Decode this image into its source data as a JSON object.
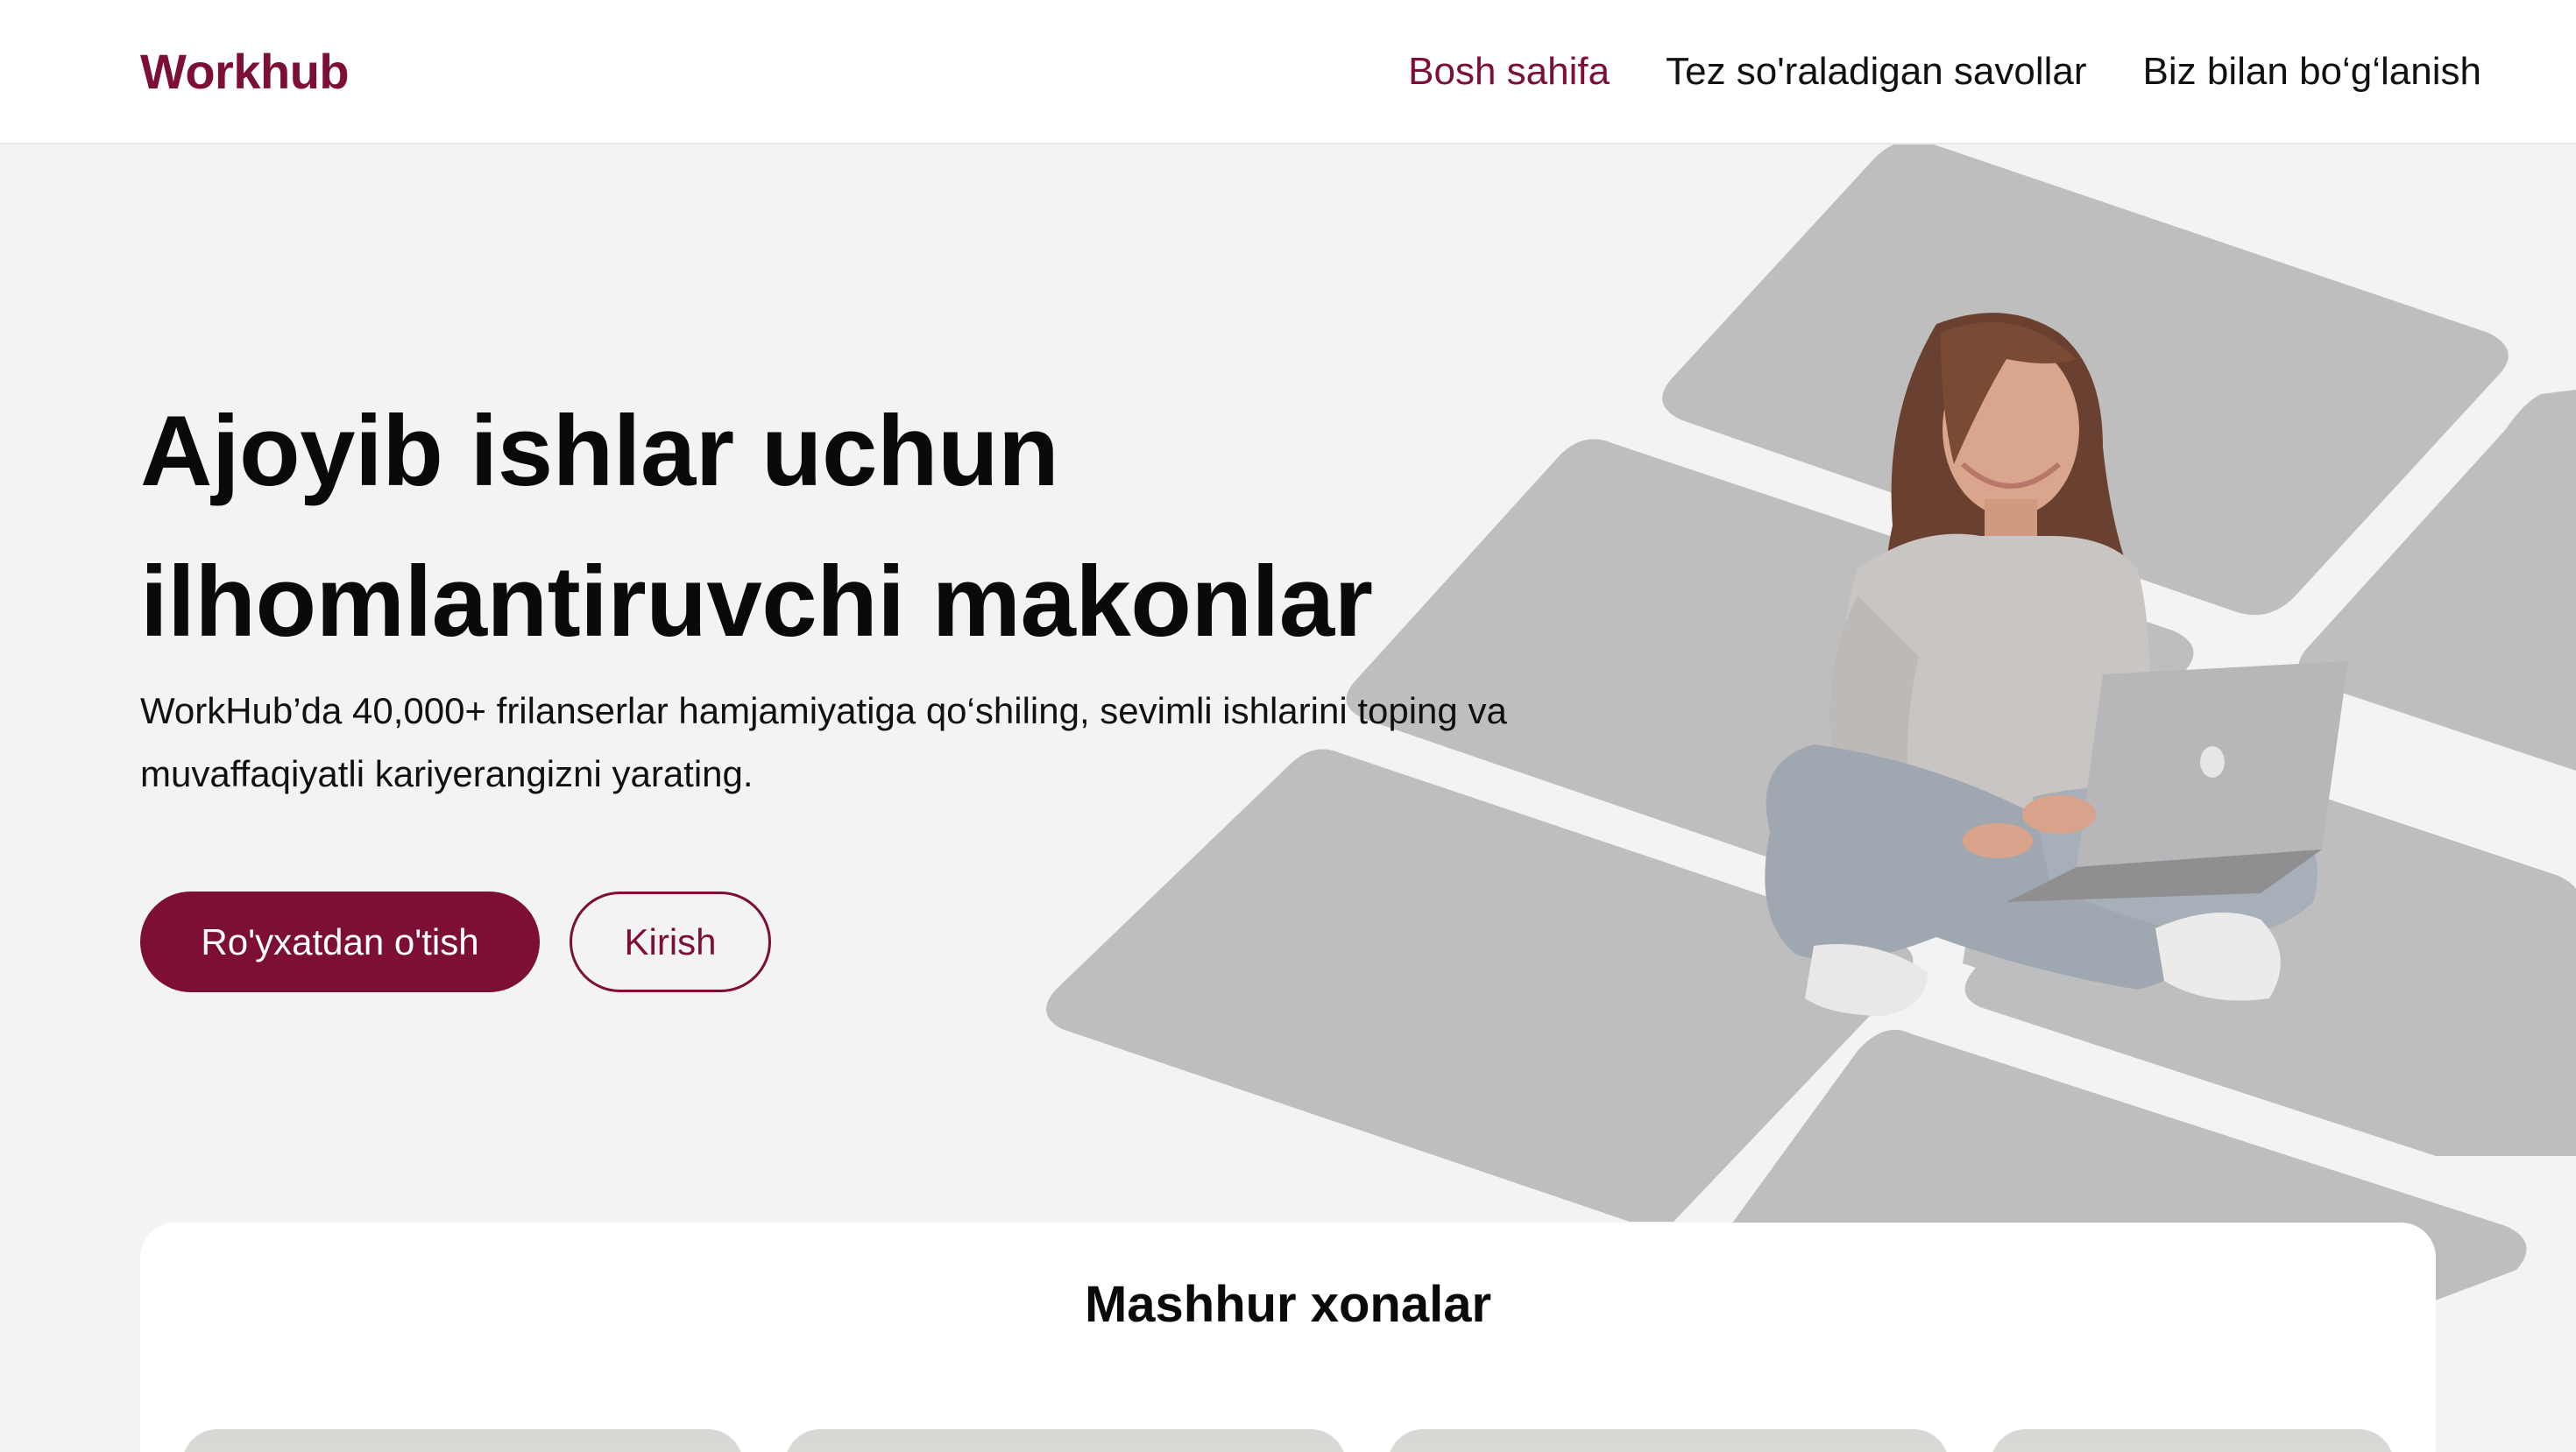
{
  "header": {
    "logo": "Workhub",
    "nav": [
      {
        "label": "Bosh sahifa",
        "active": true
      },
      {
        "label": "Tez so'raladigan savollar",
        "active": false
      },
      {
        "label": "Biz bilan bo‘g‘lanish",
        "active": false
      }
    ]
  },
  "hero": {
    "title_line1": "Ajoyib ishlar uchun",
    "title_line2": "ilhomlantiruvchi makonlar",
    "subtitle": "WorkHub’da 40,000+ frilanserlar hamjamiyatiga qo‘shiling, sevimli ishlarini toping va muvaffaqiyatli kariyerangizni yarating.",
    "primary_button": "Ro'yxatdan o'tish",
    "secondary_button": "Kirish"
  },
  "popular_rooms": {
    "title": "Mashhur xonalar"
  },
  "colors": {
    "brand": "#7d0f33",
    "background": "#f3f3f3",
    "tile": "#bebebe"
  },
  "icons": {
    "hero_illustration": "woman-with-laptop-illustration"
  }
}
